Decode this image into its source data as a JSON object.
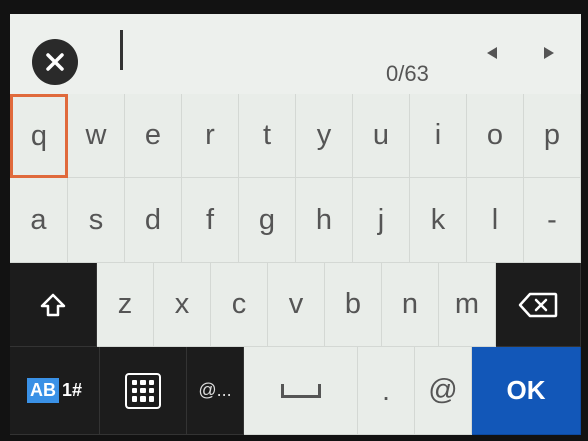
{
  "input": {
    "counter": "0/63"
  },
  "keyboard": {
    "row1": [
      "q",
      "w",
      "e",
      "r",
      "t",
      "y",
      "u",
      "i",
      "o",
      "p"
    ],
    "row2": [
      "a",
      "s",
      "d",
      "f",
      "g",
      "h",
      "j",
      "k",
      "l",
      "-"
    ],
    "row3": [
      "z",
      "x",
      "c",
      "v",
      "b",
      "n",
      "m"
    ],
    "row4": {
      "mode_ab": "AB",
      "mode_num": "1#",
      "symbols_label": "@...",
      "period": ".",
      "at": "@",
      "ok": "OK"
    }
  },
  "icons": {
    "clear": "close-icon",
    "left": "arrow-left-icon",
    "right": "arrow-right-icon",
    "shift": "shift-icon",
    "backspace": "backspace-icon",
    "keypad": "keypad-icon",
    "space": "space-icon"
  },
  "colors": {
    "selected_outline": "#e06a3c",
    "ok_blue": "#1257b8",
    "dark_key": "#1c1c1c"
  }
}
